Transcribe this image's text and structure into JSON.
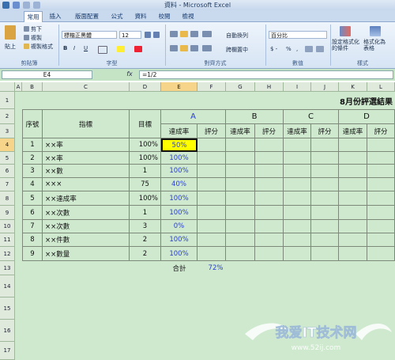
{
  "window": {
    "title": "資料 - Microsoft Excel"
  },
  "tabs": [
    "常用",
    "插入",
    "版面配置",
    "公式",
    "資料",
    "校閱",
    "檢視"
  ],
  "ribbon": {
    "clipboard": {
      "paste": "貼上",
      "cut": "剪下",
      "copy": "複製",
      "format_painter": "複製格式",
      "label": "剪貼簿"
    },
    "font": {
      "name": "標楷正黑體",
      "size": "12",
      "label": "字型"
    },
    "alignment": {
      "wrap": "自動換列",
      "merge": "跨欄置中",
      "label": "對齊方式"
    },
    "number": {
      "format": "百分比",
      "label": "數值"
    },
    "styles": {
      "conditional": "設定格式化的條件",
      "as_table": "格式化為表格",
      "label": "樣式"
    }
  },
  "formula_bar": {
    "name_box": "E4",
    "fx": "fx",
    "formula": "=1/2"
  },
  "columns": [
    "A",
    "B",
    "C",
    "D",
    "E",
    "F",
    "G",
    "H",
    "I",
    "J",
    "K",
    "L"
  ],
  "rows": [
    "1",
    "2",
    "3",
    "4",
    "5",
    "6",
    "7",
    "8",
    "9",
    "10",
    "11",
    "12",
    "13",
    "14",
    "15",
    "16",
    "17"
  ],
  "sheet": {
    "title": "8月份評選結果",
    "header_no": "序號",
    "header_index": "指標",
    "header_target": "目標",
    "groups": [
      "A",
      "B",
      "C",
      "D"
    ],
    "sub_rate": "達成率",
    "sub_score": "評分",
    "data": [
      {
        "no": "1",
        "index": "××率",
        "target": "100%",
        "rate": "50%"
      },
      {
        "no": "2",
        "index": "××率",
        "target": "100%",
        "rate": "100%"
      },
      {
        "no": "3",
        "index": "××數",
        "target": "1",
        "rate": "100%"
      },
      {
        "no": "4",
        "index": "×××",
        "target": "75",
        "rate": "40%"
      },
      {
        "no": "5",
        "index": "××達成率",
        "target": "100%",
        "rate": "100%"
      },
      {
        "no": "6",
        "index": "××次數",
        "target": "1",
        "rate": "100%"
      },
      {
        "no": "7",
        "index": "××次數",
        "target": "3",
        "rate": "0%"
      },
      {
        "no": "8",
        "index": "××件數",
        "target": "2",
        "rate": "100%"
      },
      {
        "no": "9",
        "index": "××數量",
        "target": "2",
        "rate": "100%"
      }
    ],
    "total_label": "合計",
    "total_value": "72%"
  },
  "watermark": {
    "text": "我爱IT技术网",
    "url": "www.52ij.com"
  },
  "colors": {
    "accent_blue": "#2a3fd0",
    "grid_bg": "#cfe9cf",
    "active_fill": "#ffff00"
  }
}
